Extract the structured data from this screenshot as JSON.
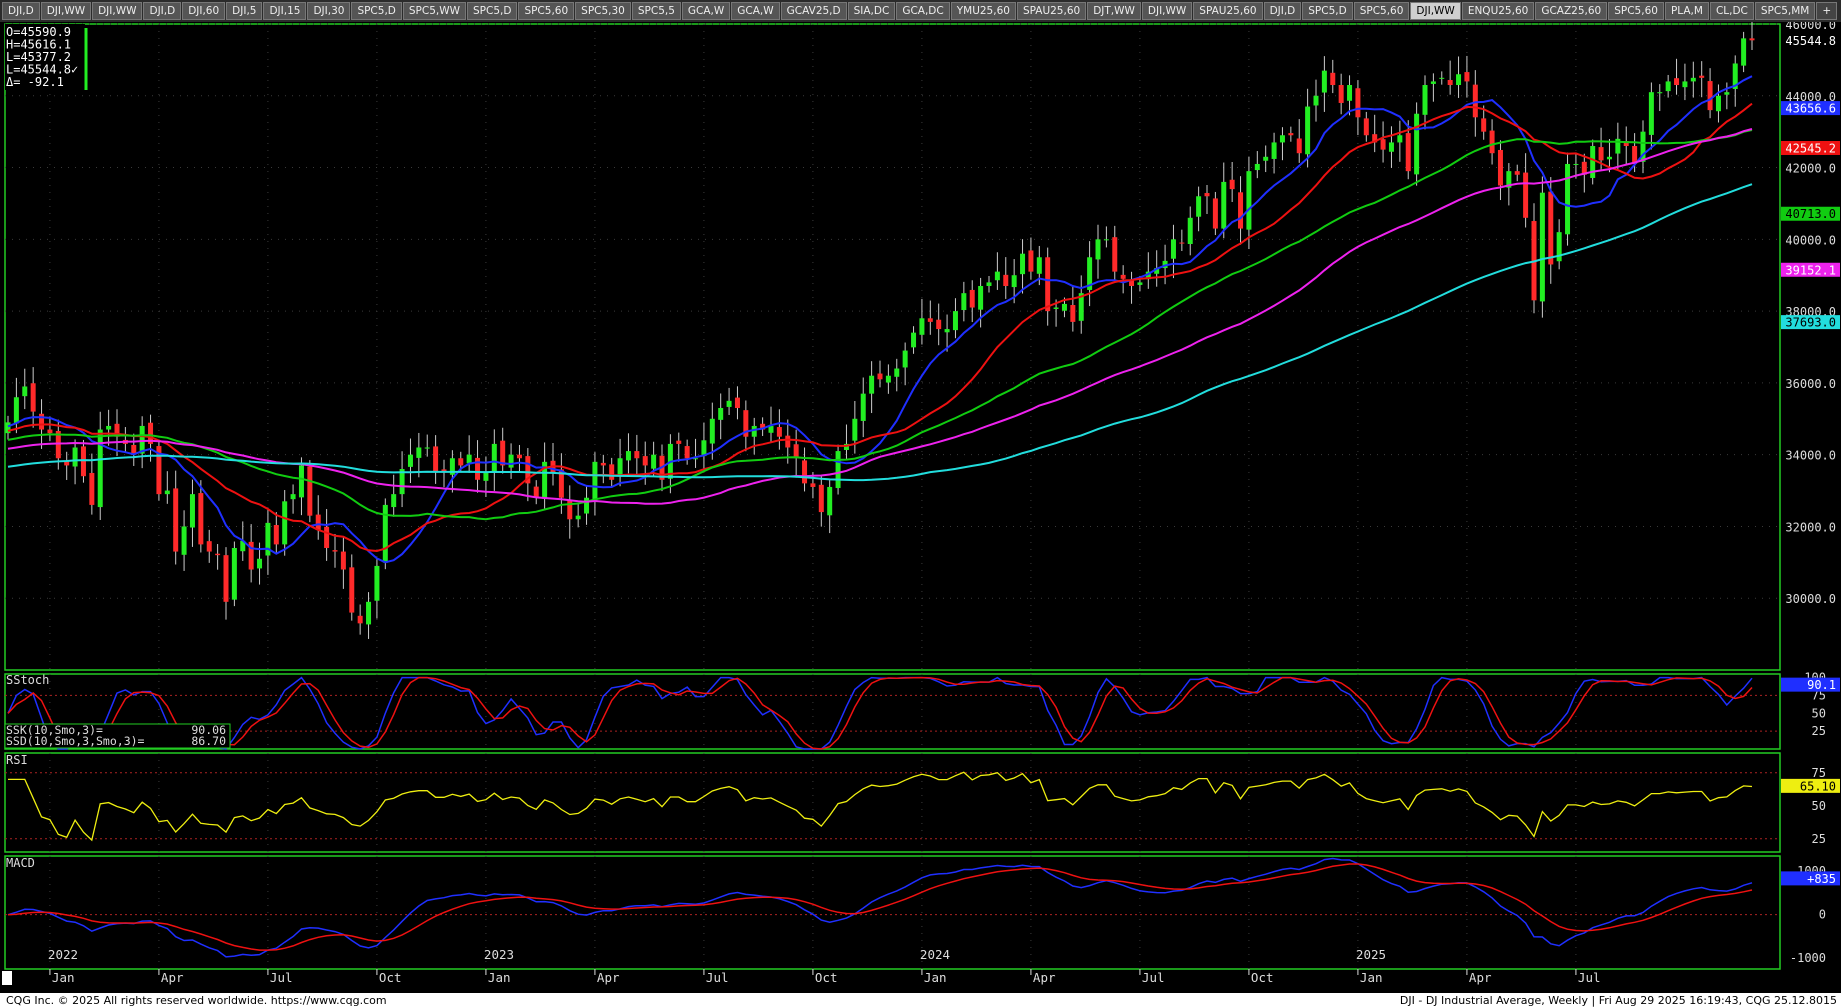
{
  "tabs": [
    "DJI,D",
    "DJI,WW",
    "DJI,WW",
    "DJI,D",
    "DJI,60",
    "DJI,5",
    "DJI,15",
    "DJI,30",
    "SPC5,D",
    "SPC5,WW",
    "SPC5,D",
    "SPC5,60",
    "SPC5,30",
    "SPC5,5",
    "GCA,W",
    "GCA,W",
    "GCAV25,D",
    "SIA,DC",
    "GCA,DC",
    "YMU25,60",
    "SPAU25,60",
    "DJT,WW",
    "DJI,WW",
    "SPAU25,60",
    "DJI,D",
    "SPC5,D",
    "SPC5,60",
    "DJI,WW",
    "ENQU25,60",
    "GCAZ25,60",
    "SPC5,60",
    "PLA,M",
    "CL,DC",
    "SPC5,MM",
    "+"
  ],
  "active_tab_index": 27,
  "ohlc_box": [
    "O=45590.9",
    "H=45616.1",
    "L=45377.2",
    "L=45544.8✓",
    "Δ=   -92.1"
  ],
  "status": {
    "copyright": "CQG Inc. © 2025 All rights reserved worldwide. https://www.cqg.com",
    "info": "DJI - DJ Industrial Average, Weekly | Fri Aug 29 2025 16:19:43, CQG 25.12.8015"
  },
  "colors": {
    "up": "#22ee22",
    "down": "#ff2a2a",
    "ma1": "#1f2fff",
    "ma2": "#ee1111",
    "ma3": "#11cc11",
    "ma4": "#ee22ee",
    "ma5": "#22dddd",
    "grid": "#3a3a3a",
    "panel_border": "#22cc22",
    "rsi": "#eeee11"
  },
  "chart_data": {
    "type": "candlestick",
    "timeframe": "weekly",
    "price_axis": {
      "min": 28000,
      "max": 46000,
      "ticks": [
        "46000.0",
        "44000.0",
        "42000.0",
        "40000.0",
        "38000.0",
        "36000.0",
        "34000.0",
        "32000.0",
        "30000.0"
      ],
      "tick_values": [
        46000,
        44000,
        42000,
        40000,
        38000,
        36000,
        34000,
        32000,
        30000
      ]
    },
    "last_price": 45544.8,
    "closes": [
      34900,
      35600,
      35900,
      35200,
      34700,
      34600,
      33900,
      33700,
      34200,
      33400,
      32600,
      34700,
      34800,
      34500,
      34300,
      34000,
      34800,
      34300,
      32900,
      33000,
      31300,
      32000,
      32900,
      31500,
      31300,
      31200,
      29900,
      31400,
      31600,
      30800,
      31100,
      32100,
      31500,
      32700,
      32900,
      33700,
      32300,
      31900,
      31400,
      31300,
      30800,
      29600,
      29300,
      29900,
      30900,
      32600,
      32900,
      33600,
      34000,
      34200,
      34200,
      33500,
      33500,
      33900,
      33700,
      34000,
      33300,
      33500,
      34300,
      33700,
      34000,
      33900,
      33200,
      32800,
      33800,
      33500,
      32800,
      32200,
      32300,
      32800,
      33800,
      33700,
      33300,
      33900,
      34100,
      33900,
      33700,
      34000,
      33300,
      34300,
      34300,
      33900,
      33900,
      34400,
      35000,
      35300,
      35500,
      35300,
      34500,
      34800,
      34700,
      34800,
      34500,
      34200,
      33900,
      33200,
      33100,
      32400,
      33100,
      34100,
      34300,
      35000,
      35700,
      36200,
      36100,
      36200,
      36400,
      36900,
      37400,
      37800,
      37700,
      37500,
      37500,
      38000,
      38500,
      38100,
      38700,
      38800,
      39100,
      38700,
      39000,
      39600,
      39100,
      39500,
      38000,
      38100,
      38200,
      37700,
      38500,
      39500,
      40000,
      40000,
      39100,
      38900,
      38700,
      38800,
      39100,
      39200,
      39400,
      40000,
      39900,
      40600,
      41200,
      41200,
      40300,
      41600,
      41400,
      40300,
      41900,
      42100,
      42300,
      42700,
      42900,
      42900,
      42400,
      43700,
      44000,
      44700,
      44300,
      43800,
      44300,
      43400,
      42900,
      42700,
      42500,
      42700,
      42900,
      41900,
      43500,
      44300,
      44400,
      44500,
      44300,
      44600,
      44400,
      43400,
      43000,
      42400,
      41500,
      41900,
      41800,
      40600,
      38300,
      41300,
      39300,
      40200,
      42100,
      42100,
      41800,
      42600,
      42200,
      42300,
      42800,
      42600,
      42100,
      43000,
      44100,
      44100,
      44400,
      44300,
      44400,
      44500,
      44500,
      43600,
      44000,
      44100,
      44900,
      45600,
      45545
    ],
    "series": [
      {
        "name": "MA blue",
        "color_key": "ma1",
        "period_hint": 10
      },
      {
        "name": "MA red",
        "color_key": "ma2",
        "period_hint": 20
      },
      {
        "name": "MA green",
        "color_key": "ma3",
        "period_hint": 40
      },
      {
        "name": "MA magenta",
        "color_key": "ma4",
        "period_hint": 60
      },
      {
        "name": "MA cyan",
        "color_key": "ma5",
        "period_hint": 100
      }
    ],
    "ma_labels": [
      {
        "value": 43656.6,
        "text": "43656.6",
        "color_key": "ma1"
      },
      {
        "value": 42545.2,
        "text": "42545.2",
        "color_key": "ma2"
      },
      {
        "value": 40713.0,
        "text": "40713.0",
        "color_key": "ma3"
      },
      {
        "value": 39152.1,
        "text": "39152.1",
        "color_key": "ma4"
      },
      {
        "value": 37693.0,
        "text": "37693.0",
        "color_key": "ma5"
      }
    ],
    "x_axis": {
      "years": [
        {
          "label": "2022",
          "week": 5
        },
        {
          "label": "2023",
          "week": 57
        },
        {
          "label": "2024",
          "week": 109
        },
        {
          "label": "2025",
          "week": 161
        }
      ],
      "months": [
        {
          "label": "Jan",
          "week": 5
        },
        {
          "label": "Apr",
          "week": 18
        },
        {
          "label": "Jul",
          "week": 31
        },
        {
          "label": "Oct",
          "week": 44
        },
        {
          "label": "Jan",
          "week": 57
        },
        {
          "label": "Apr",
          "week": 70
        },
        {
          "label": "Jul",
          "week": 83
        },
        {
          "label": "Oct",
          "week": 96
        },
        {
          "label": "Jan",
          "week": 109
        },
        {
          "label": "Apr",
          "week": 122
        },
        {
          "label": "Jul",
          "week": 135
        },
        {
          "label": "Oct",
          "week": 148
        },
        {
          "label": "Jan",
          "week": 161
        },
        {
          "label": "Apr",
          "week": 174
        },
        {
          "label": "Jul",
          "week": 187
        }
      ]
    },
    "stoch": {
      "title": "SStoch",
      "k_label": "SSK(10,Smo,3)=",
      "k_value": "90.06",
      "d_label": "SSD(10,Smo,3,Smo,3)=",
      "d_value": "86.70",
      "last": "90.1",
      "ticks": [
        "100",
        "75",
        "50",
        "25"
      ],
      "tick_values": [
        100,
        75,
        50,
        25
      ]
    },
    "rsi": {
      "title": "RSI",
      "last": "65.10",
      "ticks": [
        "75",
        "50",
        "25"
      ],
      "tick_values": [
        75,
        50,
        25
      ]
    },
    "macd": {
      "title": "MACD",
      "last": "+835",
      "ticks": [
        "1000",
        "0",
        "-1000"
      ],
      "tick_values": [
        1000,
        0,
        -1000
      ]
    }
  }
}
